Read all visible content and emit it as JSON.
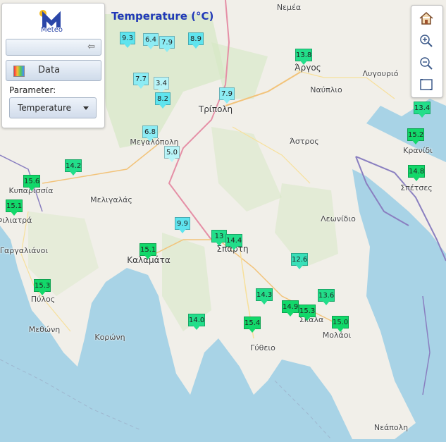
{
  "title": "Temperature (°C)",
  "panel": {
    "logo_text": "Meteo",
    "data_label": "Data",
    "parameter_label": "Parameter:",
    "parameter_value": "Temperature"
  },
  "tools": [
    "home-icon",
    "zoom-in-icon",
    "zoom-out-icon",
    "zoom-extent-icon"
  ],
  "places": [
    {
      "name": "Νεμέα",
      "city": false
    },
    {
      "name": "Άργος",
      "city": true
    },
    {
      "name": "Λυγουριό",
      "city": false
    },
    {
      "name": "Ναύπλιο",
      "city": false
    },
    {
      "name": "Τρίπολη",
      "city": true
    },
    {
      "name": "Άστρος",
      "city": false
    },
    {
      "name": "Κρανίδι",
      "city": false
    },
    {
      "name": "Σπέτσες",
      "city": false
    },
    {
      "name": "Μεγαλόπολη",
      "city": false
    },
    {
      "name": "Κυπαρισσία",
      "city": false
    },
    {
      "name": "Μελιγαλάς",
      "city": false
    },
    {
      "name": "Φιλιατρά",
      "city": false
    },
    {
      "name": "Λεωνίδιο",
      "city": false
    },
    {
      "name": "Γαργαλιάνοι",
      "city": false
    },
    {
      "name": "Καλαμάτα",
      "city": true
    },
    {
      "name": "Σπάρτη",
      "city": true
    },
    {
      "name": "Πύλος",
      "city": false
    },
    {
      "name": "Μεθώνη",
      "city": false
    },
    {
      "name": "Κορώνη",
      "city": false
    },
    {
      "name": "Σκάλα",
      "city": false
    },
    {
      "name": "Μολάοι",
      "city": false
    },
    {
      "name": "Γύθειο",
      "city": false
    },
    {
      "name": "Νεάπολη",
      "city": false
    }
  ],
  "markers": [
    {
      "value": "9.3"
    },
    {
      "value": "6.4"
    },
    {
      "value": "7.9"
    },
    {
      "value": "8.9"
    },
    {
      "value": "13.8"
    },
    {
      "value": "7.7"
    },
    {
      "value": "3.4"
    },
    {
      "value": "8.2"
    },
    {
      "value": "7.9"
    },
    {
      "value": "13.4"
    },
    {
      "value": "6.8"
    },
    {
      "value": "15.2"
    },
    {
      "value": "5.0"
    },
    {
      "value": "14.2"
    },
    {
      "value": "14.8"
    },
    {
      "value": "15.6"
    },
    {
      "value": "15.1"
    },
    {
      "value": "9.9"
    },
    {
      "value": "13"
    },
    {
      "value": "14.4"
    },
    {
      "value": "15.1"
    },
    {
      "value": "12.6"
    },
    {
      "value": "15.3"
    },
    {
      "value": "14.3"
    },
    {
      "value": "13.6"
    },
    {
      "value": "14.9"
    },
    {
      "value": "15.3"
    },
    {
      "value": "14.0"
    },
    {
      "value": "15.4"
    },
    {
      "value": "15.0"
    }
  ]
}
